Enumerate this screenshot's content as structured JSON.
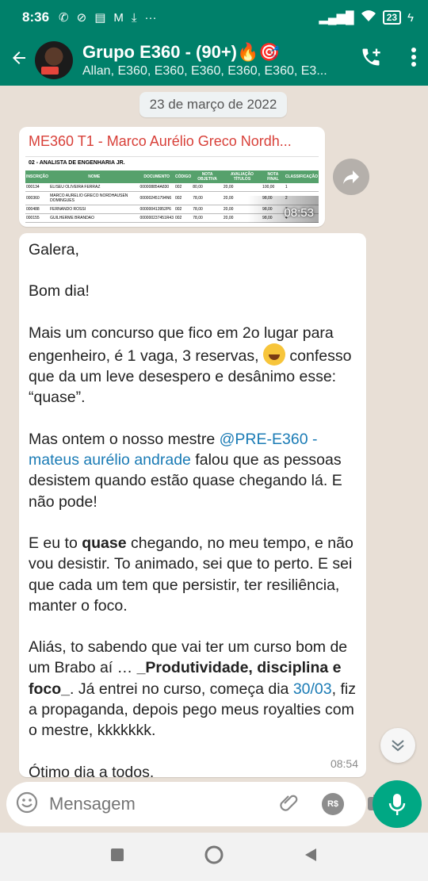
{
  "status": {
    "time": "8:36",
    "battery": "23"
  },
  "header": {
    "title": "Grupo E360 - (90+)🔥🎯",
    "subtitle": "Allan, E360, E360, E360, E360, E360, E3..."
  },
  "chat": {
    "date_chip": "23 de março de 2022",
    "doc_message": {
      "title": "ME360 T1 - Marco Aurélio Greco Nordh...",
      "doc_subtitle": "02 - ANALISTA DE ENGENHARIA JR.",
      "table_headers": [
        "INSCRIÇÃO",
        "NOME",
        "DOCUMENTO",
        "CÓDIGO",
        "NOTA OBJETIVA",
        "AVALIAÇÃO TÍTULOS",
        "NOTA FINAL",
        "CLASSIFICAÇÃO"
      ],
      "table_rows": [
        [
          "000134",
          "ELISEU OLIVEIRA FERRAZ",
          "000008854A830",
          "002",
          "80,00",
          "20,00",
          "100,00",
          "1"
        ],
        [
          "000360",
          "MARCO AURELIO GRECO NORDHAUSEN DOMINGUES",
          "000002451794N6",
          "002",
          "78,00",
          "20,00",
          "98,00",
          "2"
        ],
        [
          "000488",
          "FERNANDO ROSSI",
          "000000413952P6",
          "002",
          "78,00",
          "20,00",
          "98,00",
          "3"
        ],
        [
          "000155",
          "GUILHERME BRANDAO",
          "000000237451R43",
          "002",
          "78,00",
          "20,00",
          "98,00",
          "4"
        ]
      ],
      "time": "08:53"
    },
    "text_message": {
      "p1": "Galera,",
      "p2": "Bom dia!",
      "p3": "Mais um concurso que fico em 2o lugar para engenheiro, é 1 vaga, 3 reservas,",
      "p3b": "confesso que da um leve desespero e desânimo esse: “quase”.",
      "p4a": "Mas ontem o nosso mestre ",
      "p4link": "@PRE-E360 - mateus aurélio andrade",
      "p4b": " falou que as pessoas desistem quando estão quase chegando lá. E não pode!",
      "p5a": "E eu to ",
      "p5bold": "quase",
      "p5b": " chegando, no meu tempo, e não vou desistir. To animado, sei que to perto. E sei que cada um tem que persistir, ter resiliência, manter o foco.",
      "p6a": "Aliás, to sabendo que vai ter um curso bom de um Brabo aí … ",
      "p6bold": "_Produtividade, disciplina e foco_",
      "p6b": ". Já entrei no curso, começa dia ",
      "p6link": "30/03",
      "p6c": ", fiz a propaganda, depois pego meus royalties com o mestre, kkkkkkk.",
      "p7": "Ótimo dia a todos.",
      "time": "08:54"
    }
  },
  "composer": {
    "placeholder": "Mensagem",
    "currency_label": "R$"
  },
  "colors": {
    "header": "#00806a",
    "accent": "#00a884",
    "link": "#1a7bb5",
    "doc_title": "#d84039"
  }
}
